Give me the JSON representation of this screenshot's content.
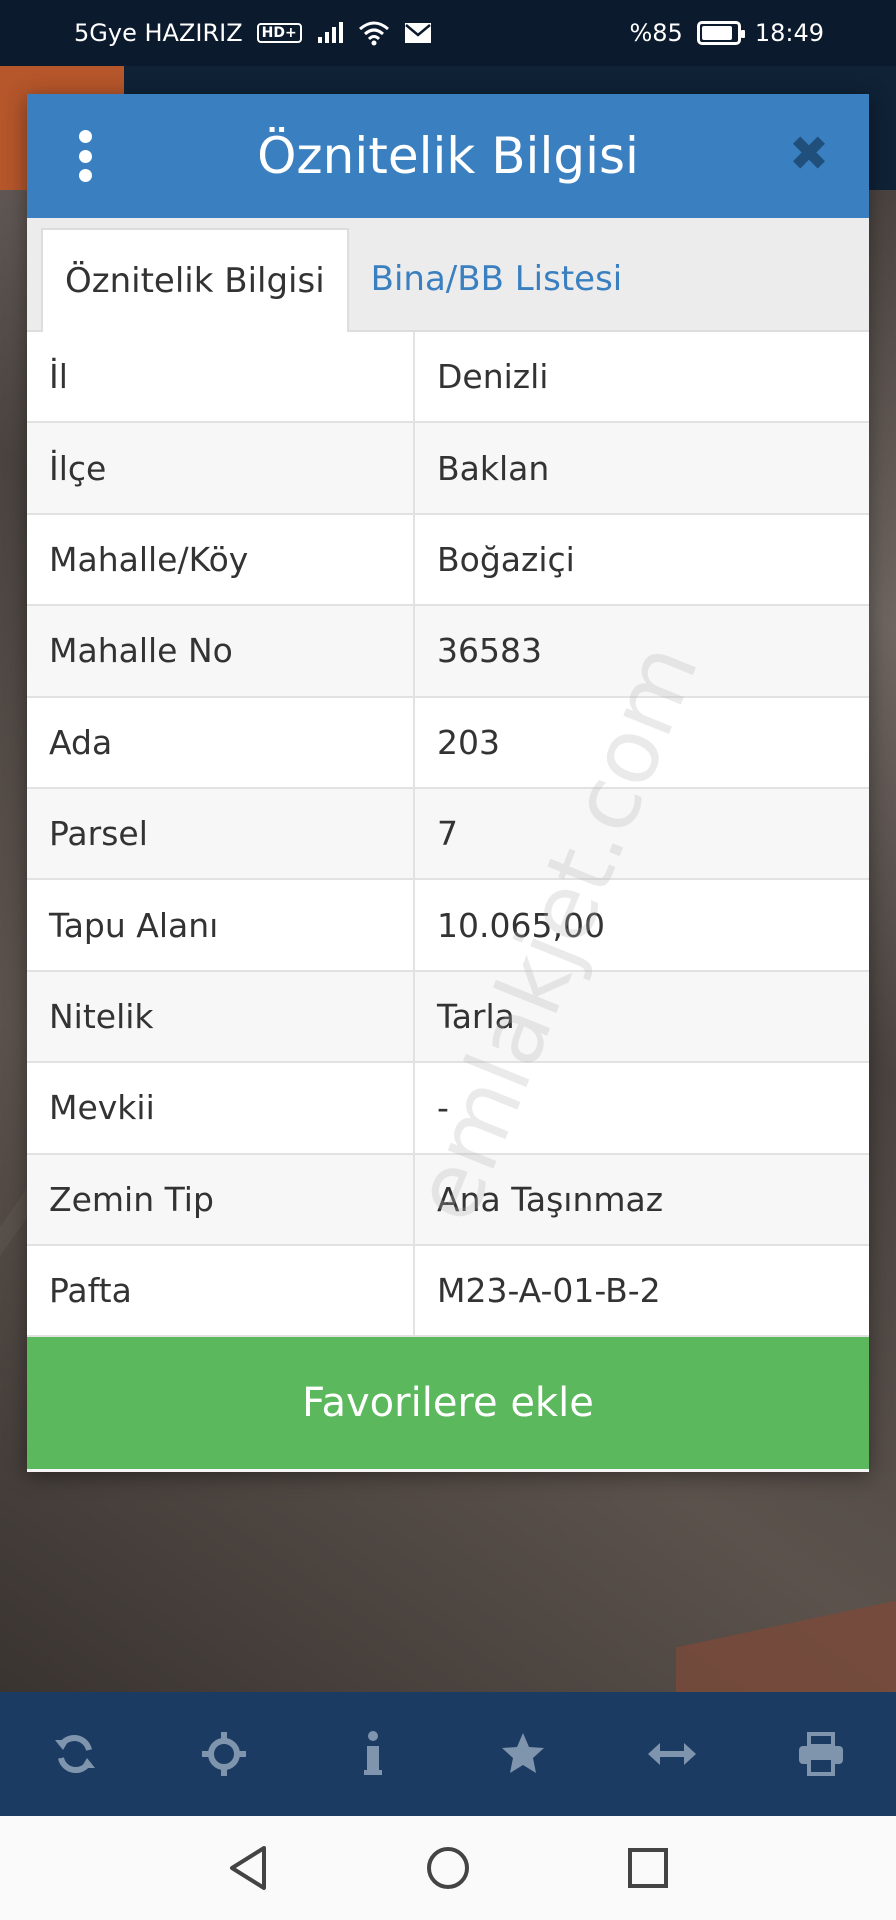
{
  "status_bar": {
    "carrier": "5Gye HAZIRIZ",
    "hd_badge": "HD+",
    "battery_percent": "%85",
    "time": "18:49"
  },
  "dialog": {
    "title": "Öznitelik Bilgisi",
    "tabs": [
      {
        "label": "Öznitelik Bilgisi",
        "active": true
      },
      {
        "label": "Bina/BB Listesi",
        "active": false
      }
    ],
    "rows": [
      {
        "label": "İl",
        "value": "Denizli"
      },
      {
        "label": "İlçe",
        "value": "Baklan"
      },
      {
        "label": "Mahalle/Köy",
        "value": "Boğaziçi"
      },
      {
        "label": "Mahalle No",
        "value": "36583"
      },
      {
        "label": "Ada",
        "value": "203"
      },
      {
        "label": "Parsel",
        "value": "7"
      },
      {
        "label": "Tapu Alanı",
        "value": "10.065,00"
      },
      {
        "label": "Nitelik",
        "value": "Tarla"
      },
      {
        "label": "Mevkii",
        "value": "-"
      },
      {
        "label": "Zemin Tip",
        "value": "Ana Taşınmaz"
      },
      {
        "label": "Pafta",
        "value": "M23-A-01-B-2"
      }
    ],
    "favorite_button": "Favorilere ekle"
  },
  "watermark": "emlakjet.com",
  "toolbar": {
    "icons": [
      "refresh-icon",
      "locate-icon",
      "info-icon",
      "star-icon",
      "measure-icon",
      "print-icon"
    ]
  },
  "colors": {
    "header": "#3a7fc0",
    "favorite": "#5cb85c",
    "toolbar": "#1c3b62"
  }
}
